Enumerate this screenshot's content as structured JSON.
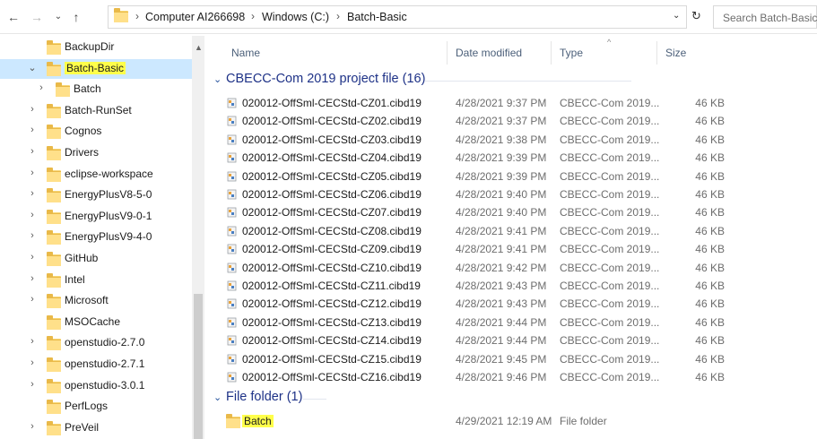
{
  "address": {
    "breadcrumbs": [
      "Computer AI266698",
      "Windows (C:)",
      "Batch-Basic"
    ],
    "search_placeholder": "Search Batch-Basic"
  },
  "nav": {
    "items": [
      {
        "label": "BackupDir",
        "chevron": "",
        "indent": 0,
        "selected": false,
        "highlight": false
      },
      {
        "label": "Batch-Basic",
        "chevron": "⌄",
        "indent": 0,
        "selected": true,
        "highlight": true
      },
      {
        "label": "Batch",
        "chevron": "›",
        "indent": 1,
        "selected": false,
        "highlight": false
      },
      {
        "label": "Batch-RunSet",
        "chevron": "›",
        "indent": 0,
        "selected": false,
        "highlight": false
      },
      {
        "label": "Cognos",
        "chevron": "›",
        "indent": 0,
        "selected": false,
        "highlight": false
      },
      {
        "label": "Drivers",
        "chevron": "›",
        "indent": 0,
        "selected": false,
        "highlight": false
      },
      {
        "label": "eclipse-workspace",
        "chevron": "›",
        "indent": 0,
        "selected": false,
        "highlight": false
      },
      {
        "label": "EnergyPlusV8-5-0",
        "chevron": "›",
        "indent": 0,
        "selected": false,
        "highlight": false
      },
      {
        "label": "EnergyPlusV9-0-1",
        "chevron": "›",
        "indent": 0,
        "selected": false,
        "highlight": false
      },
      {
        "label": "EnergyPlusV9-4-0",
        "chevron": "›",
        "indent": 0,
        "selected": false,
        "highlight": false
      },
      {
        "label": "GitHub",
        "chevron": "›",
        "indent": 0,
        "selected": false,
        "highlight": false
      },
      {
        "label": "Intel",
        "chevron": "›",
        "indent": 0,
        "selected": false,
        "highlight": false
      },
      {
        "label": "Microsoft",
        "chevron": "›",
        "indent": 0,
        "selected": false,
        "highlight": false
      },
      {
        "label": "MSOCache",
        "chevron": "",
        "indent": 0,
        "selected": false,
        "highlight": false
      },
      {
        "label": "openstudio-2.7.0",
        "chevron": "›",
        "indent": 0,
        "selected": false,
        "highlight": false
      },
      {
        "label": "openstudio-2.7.1",
        "chevron": "›",
        "indent": 0,
        "selected": false,
        "highlight": false
      },
      {
        "label": "openstudio-3.0.1",
        "chevron": "›",
        "indent": 0,
        "selected": false,
        "highlight": false
      },
      {
        "label": "PerfLogs",
        "chevron": "",
        "indent": 0,
        "selected": false,
        "highlight": false
      },
      {
        "label": "PreVeil",
        "chevron": "›",
        "indent": 0,
        "selected": false,
        "highlight": false
      }
    ]
  },
  "columns": {
    "name": "Name",
    "date": "Date modified",
    "type": "Type",
    "size": "Size"
  },
  "groups": [
    {
      "title": "CBECC-Com 2019 project file (16)",
      "files": [
        {
          "name": "020012-OffSml-CECStd-CZ01.cibd19",
          "date": "4/28/2021 9:37 PM",
          "type": "CBECC-Com 2019...",
          "size": "46 KB"
        },
        {
          "name": "020012-OffSml-CECStd-CZ02.cibd19",
          "date": "4/28/2021 9:37 PM",
          "type": "CBECC-Com 2019...",
          "size": "46 KB"
        },
        {
          "name": "020012-OffSml-CECStd-CZ03.cibd19",
          "date": "4/28/2021 9:38 PM",
          "type": "CBECC-Com 2019...",
          "size": "46 KB"
        },
        {
          "name": "020012-OffSml-CECStd-CZ04.cibd19",
          "date": "4/28/2021 9:39 PM",
          "type": "CBECC-Com 2019...",
          "size": "46 KB"
        },
        {
          "name": "020012-OffSml-CECStd-CZ05.cibd19",
          "date": "4/28/2021 9:39 PM",
          "type": "CBECC-Com 2019...",
          "size": "46 KB"
        },
        {
          "name": "020012-OffSml-CECStd-CZ06.cibd19",
          "date": "4/28/2021 9:40 PM",
          "type": "CBECC-Com 2019...",
          "size": "46 KB"
        },
        {
          "name": "020012-OffSml-CECStd-CZ07.cibd19",
          "date": "4/28/2021 9:40 PM",
          "type": "CBECC-Com 2019...",
          "size": "46 KB"
        },
        {
          "name": "020012-OffSml-CECStd-CZ08.cibd19",
          "date": "4/28/2021 9:41 PM",
          "type": "CBECC-Com 2019...",
          "size": "46 KB"
        },
        {
          "name": "020012-OffSml-CECStd-CZ09.cibd19",
          "date": "4/28/2021 9:41 PM",
          "type": "CBECC-Com 2019...",
          "size": "46 KB"
        },
        {
          "name": "020012-OffSml-CECStd-CZ10.cibd19",
          "date": "4/28/2021 9:42 PM",
          "type": "CBECC-Com 2019...",
          "size": "46 KB"
        },
        {
          "name": "020012-OffSml-CECStd-CZ11.cibd19",
          "date": "4/28/2021 9:43 PM",
          "type": "CBECC-Com 2019...",
          "size": "46 KB"
        },
        {
          "name": "020012-OffSml-CECStd-CZ12.cibd19",
          "date": "4/28/2021 9:43 PM",
          "type": "CBECC-Com 2019...",
          "size": "46 KB"
        },
        {
          "name": "020012-OffSml-CECStd-CZ13.cibd19",
          "date": "4/28/2021 9:44 PM",
          "type": "CBECC-Com 2019...",
          "size": "46 KB"
        },
        {
          "name": "020012-OffSml-CECStd-CZ14.cibd19",
          "date": "4/28/2021 9:44 PM",
          "type": "CBECC-Com 2019...",
          "size": "46 KB"
        },
        {
          "name": "020012-OffSml-CECStd-CZ15.cibd19",
          "date": "4/28/2021 9:45 PM",
          "type": "CBECC-Com 2019...",
          "size": "46 KB"
        },
        {
          "name": "020012-OffSml-CECStd-CZ16.cibd19",
          "date": "4/28/2021 9:46 PM",
          "type": "CBECC-Com 2019...",
          "size": "46 KB"
        }
      ]
    },
    {
      "title": "File folder (1)",
      "folders": [
        {
          "name": "Batch",
          "date": "4/29/2021 12:19 AM",
          "type": "File folder",
          "size": ""
        }
      ]
    }
  ],
  "colors": {
    "selection": "#cce8ff",
    "highlight": "#ffff4a",
    "group_title": "#1e3287"
  }
}
